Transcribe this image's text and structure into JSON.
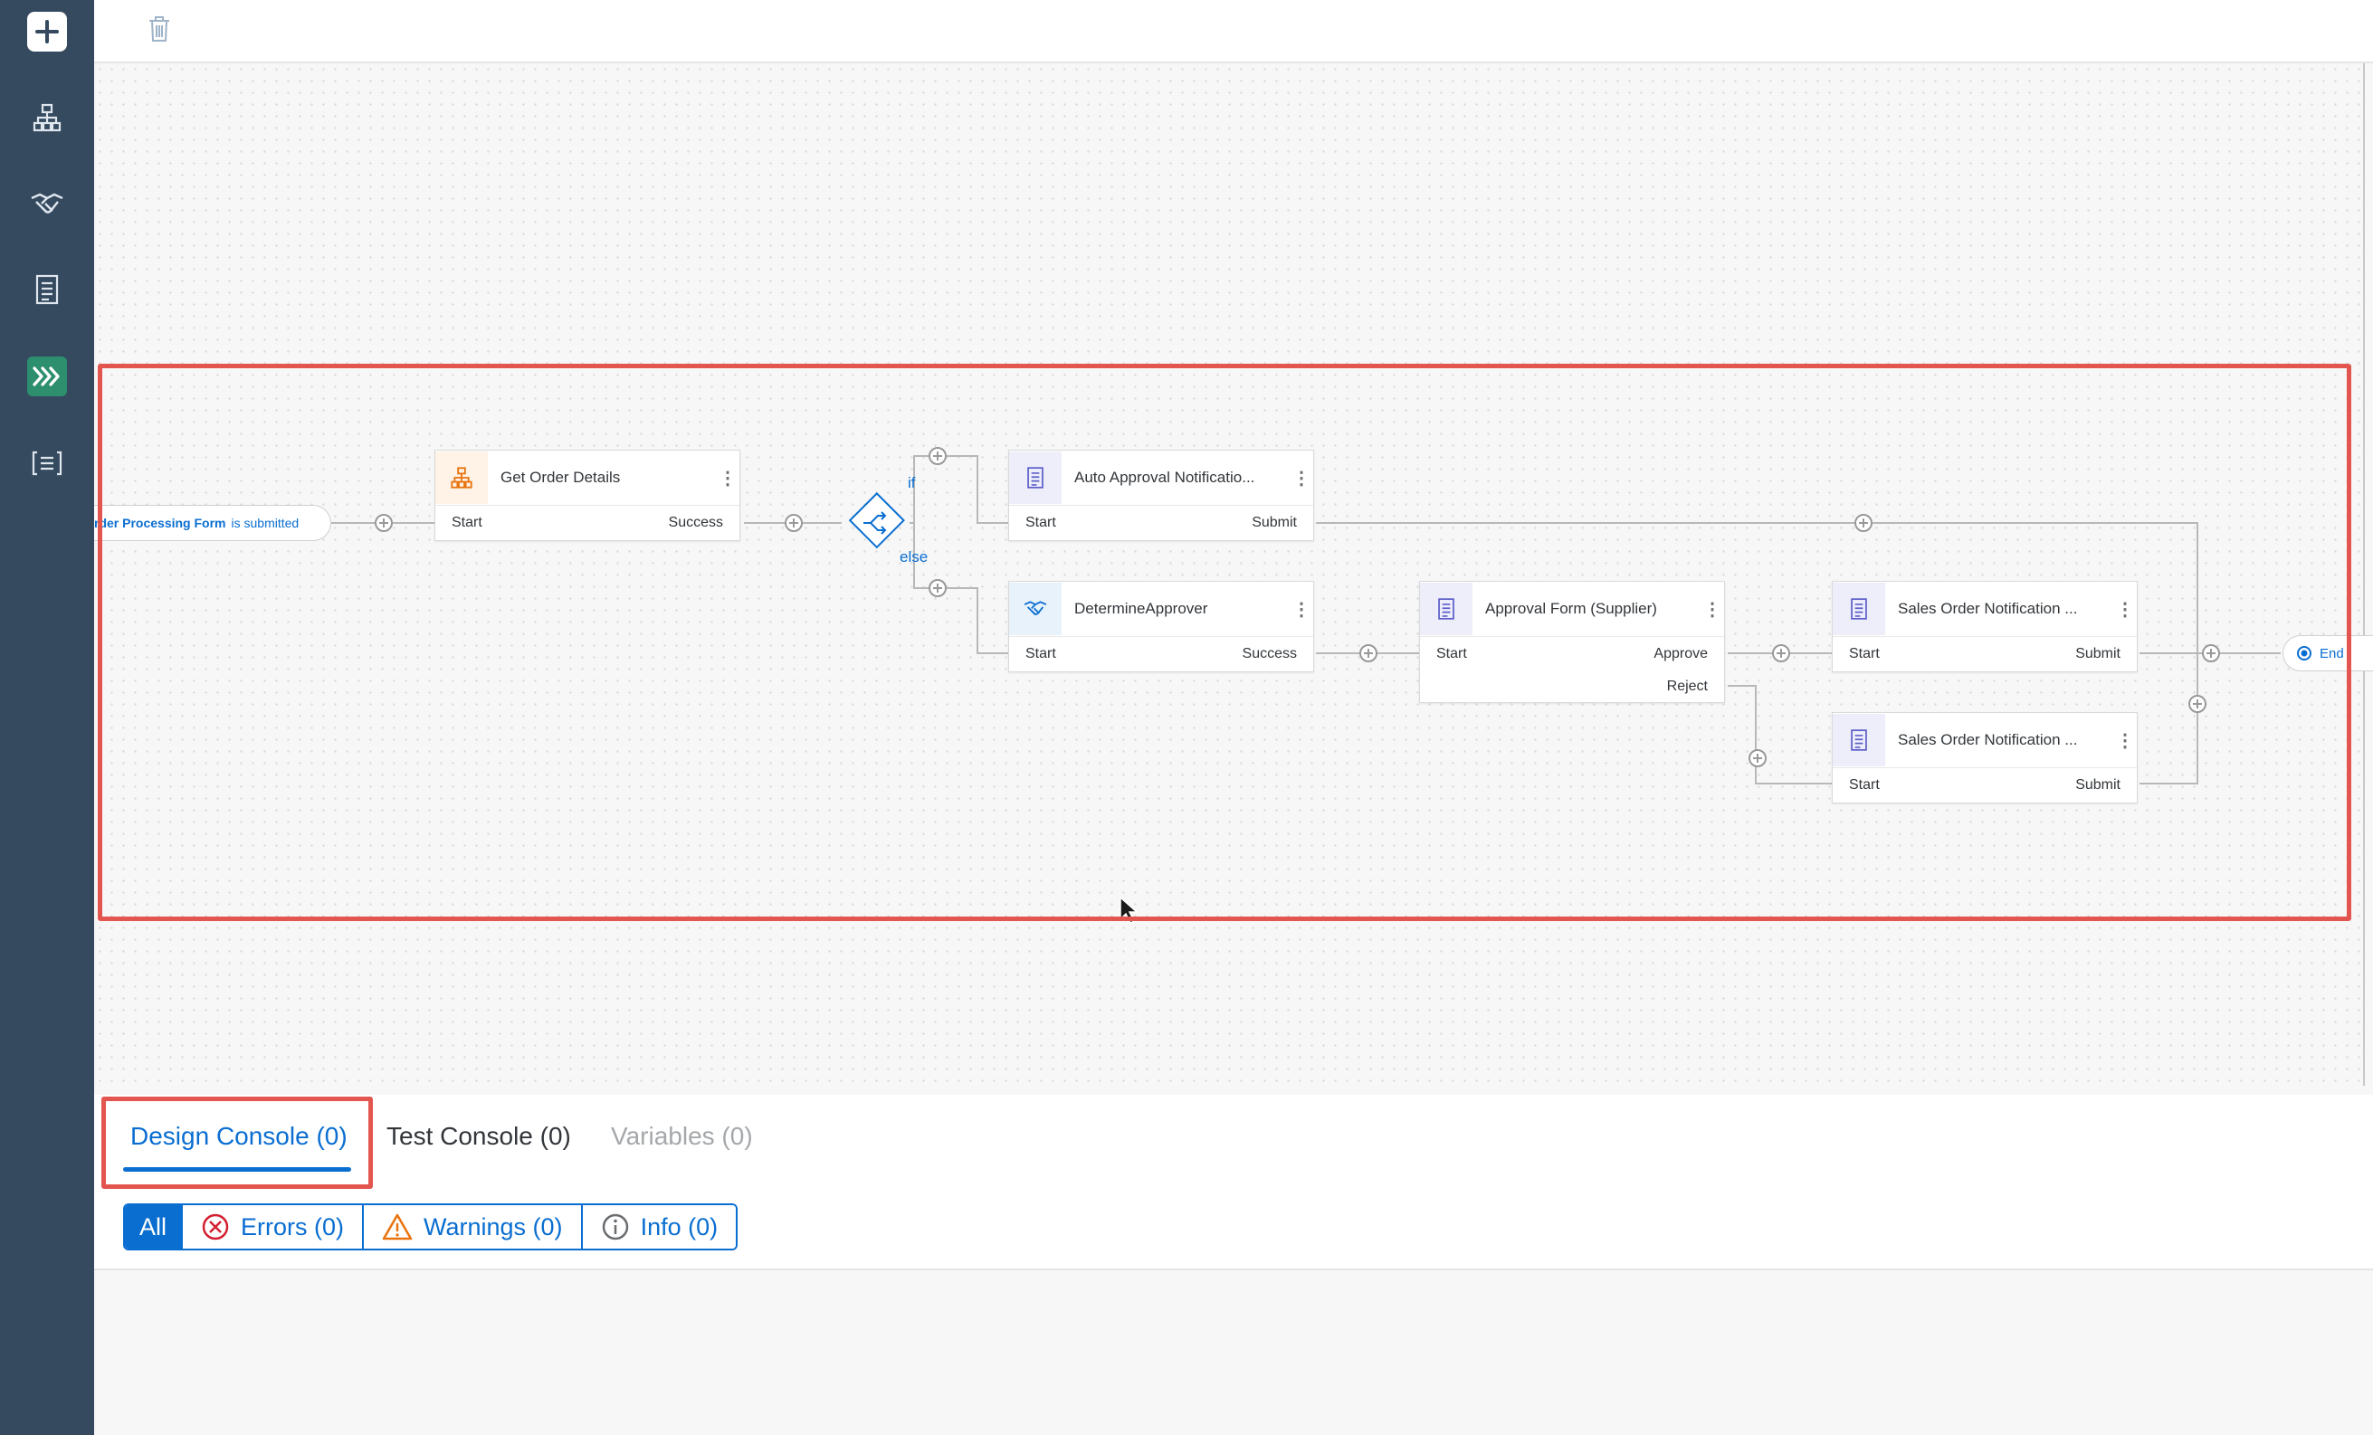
{
  "sidebar": {
    "items": [
      {
        "icon": "plus-icon",
        "active": false
      },
      {
        "icon": "hierarchy-icon",
        "active": false
      },
      {
        "icon": "handshake-icon",
        "active": false
      },
      {
        "icon": "form-icon",
        "active": false
      },
      {
        "icon": "process-icon",
        "active": true
      },
      {
        "icon": "list-icon",
        "active": false
      }
    ]
  },
  "toolbar": {
    "delete_icon": "trash-icon"
  },
  "flow": {
    "trigger": {
      "form_name": "rder Processing Form",
      "suffix": "is submitted"
    },
    "branch": {
      "if_label": "if",
      "else_label": "else"
    },
    "nodes": [
      {
        "id": "get-order-details",
        "title": "Get Order Details",
        "icon": "hierarchy-icon",
        "left": "Start",
        "right": "Success"
      },
      {
        "id": "auto-approval-notification",
        "title": "Auto Approval Notificatio...",
        "icon": "form-icon",
        "left": "Start",
        "right": "Submit"
      },
      {
        "id": "determine-approver",
        "title": "DetermineApprover",
        "icon": "handshake-icon",
        "left": "Start",
        "right": "Success"
      },
      {
        "id": "approval-form-supplier",
        "title": "Approval Form (Supplier)",
        "icon": "form-icon",
        "left": "Start",
        "right": "Approve",
        "right2": "Reject"
      },
      {
        "id": "sales-order-notification-1",
        "title": "Sales Order Notification ...",
        "icon": "form-icon",
        "left": "Start",
        "right": "Submit"
      },
      {
        "id": "sales-order-notification-2",
        "title": "Sales Order Notification ...",
        "icon": "form-icon",
        "left": "Start",
        "right": "Submit"
      }
    ],
    "end_label": "End"
  },
  "console": {
    "tabs": [
      "Design Console (0)",
      "Test Console (0)",
      "Variables (0)"
    ],
    "filters": {
      "all": "All",
      "errors": "Errors (0)",
      "warnings": "Warnings (0)",
      "info": "Info (0)"
    }
  },
  "colors": {
    "sidebar": "#354a5f",
    "accent": "#0a6ed1",
    "highlight": "#e3564f",
    "active_nav": "#2e8f6f",
    "error": "#d32030",
    "warning": "#e9730c"
  }
}
